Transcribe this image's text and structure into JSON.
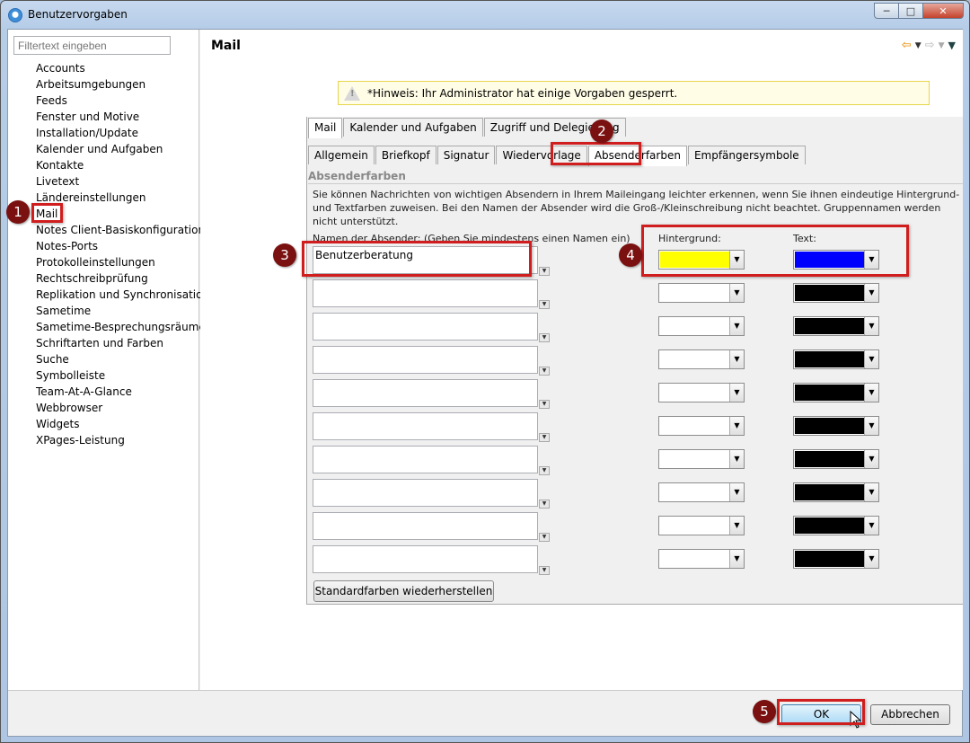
{
  "window": {
    "title": "Benutzervorgaben",
    "min_label": "─",
    "max_label": "□",
    "close_label": "✕"
  },
  "left": {
    "filter_placeholder": "Filtertext eingeben",
    "items": [
      "Accounts",
      "Arbeitsumgebungen",
      "Feeds",
      "Fenster und Motive",
      "Installation/Update",
      "Kalender und Aufgaben",
      "Kontakte",
      "Livetext",
      "Ländereinstellungen",
      "Mail",
      "Notes Client-Basiskonfiguration",
      "Notes-Ports",
      "Protokolleinstellungen",
      "Rechtschreibprüfung",
      "Replikation und Synchronisation",
      "Sametime",
      "Sametime-Besprechungsräume",
      "Schriftarten und Farben",
      "Suche",
      "Symbolleiste",
      "Team-At-A-Glance",
      "Webbrowser",
      "Widgets",
      "XPages-Leistung"
    ],
    "selected": "Mail"
  },
  "main": {
    "title": "Mail",
    "notice": "*Hinweis: Ihr Administrator hat einige Vorgaben gesperrt.",
    "tabs_primary": [
      "Mail",
      "Kalender und Aufgaben",
      "Zugriff und Delegierung"
    ],
    "tabs_secondary": [
      "Allgemein",
      "Briefkopf",
      "Signatur",
      "Wiedervorlage",
      "Absenderfarben",
      "Empfängersymbole"
    ],
    "active_secondary": "Absenderfarben",
    "section_title": "Absenderfarben",
    "description": "Sie können Nachrichten von wichtigen Absendern in Ihrem Maileingang leichter erkennen, wenn Sie ihnen eindeutige Hintergrund- und Textfarben zuweisen. Bei den Namen der Absender wird die Groß-/Kleinschreibung nicht beachtet. Gruppennamen werden nicht unterstützt.",
    "names_label": "Namen der Absender: (Geben Sie mindestens einen Namen ein)",
    "bg_label": "Hintergrund:",
    "text_label": "Text:",
    "rows": [
      {
        "name": "Benutzerberatung",
        "bg": "#ffff00",
        "fg": "#0000ff"
      },
      {
        "name": "",
        "bg": "#ffffff",
        "fg": "#000000"
      },
      {
        "name": "",
        "bg": "#ffffff",
        "fg": "#000000"
      },
      {
        "name": "",
        "bg": "#ffffff",
        "fg": "#000000"
      },
      {
        "name": "",
        "bg": "#ffffff",
        "fg": "#000000"
      },
      {
        "name": "",
        "bg": "#ffffff",
        "fg": "#000000"
      },
      {
        "name": "",
        "bg": "#ffffff",
        "fg": "#000000"
      },
      {
        "name": "",
        "bg": "#ffffff",
        "fg": "#000000"
      },
      {
        "name": "",
        "bg": "#ffffff",
        "fg": "#000000"
      },
      {
        "name": "",
        "bg": "#ffffff",
        "fg": "#000000"
      }
    ],
    "restore_label": "Standardfarben wiederherstellen"
  },
  "footer": {
    "ok_label": "OK",
    "cancel_label": "Abbrechen"
  },
  "annotations": [
    "1",
    "2",
    "3",
    "4",
    "5"
  ]
}
